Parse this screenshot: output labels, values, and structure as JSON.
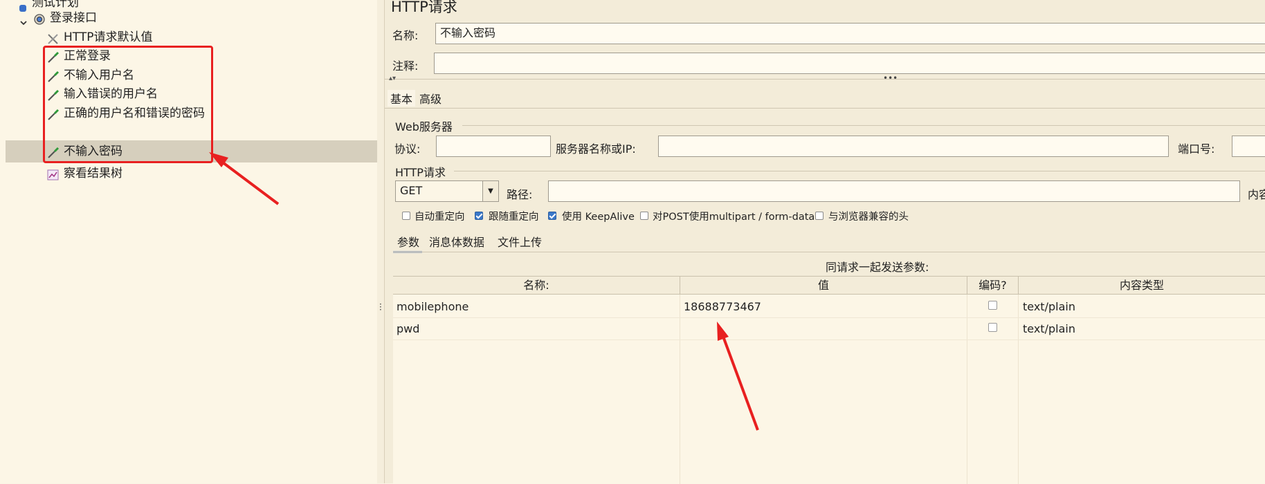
{
  "tree": {
    "items": [
      {
        "label": "测试计划"
      },
      {
        "label": "登录接口"
      },
      {
        "label": "HTTP请求默认值"
      },
      {
        "label": "正常登录"
      },
      {
        "label": "不输入用户名"
      },
      {
        "label": "输入错误的用户名"
      },
      {
        "label": "正确的用户名和错误的密码"
      },
      {
        "label": "不输入密码"
      },
      {
        "label": "察看结果树"
      }
    ]
  },
  "panel": {
    "title": "HTTP请求",
    "name_label": "名称:",
    "name_value": "不输入密码",
    "comment_label": "注释:",
    "comment_value": "",
    "tabs": [
      "基本",
      "高级"
    ],
    "web_server": {
      "group_label": "Web服务器",
      "protocol_label": "协议:",
      "protocol_value": "",
      "server_label": "服务器名称或IP:",
      "server_value": "",
      "port_label": "端口号:",
      "port_value": ""
    },
    "http_request": {
      "group_label": "HTTP请求",
      "method": "GET",
      "path_label": "路径:",
      "path_value": "",
      "content_encoding_label_partial": "内容",
      "options": [
        {
          "label": "自动重定向",
          "checked": false
        },
        {
          "label": "跟随重定向",
          "checked": true
        },
        {
          "label": "使用 KeepAlive",
          "checked": true
        },
        {
          "label": "对POST使用multipart / form-data",
          "checked": false
        },
        {
          "label": "与浏览器兼容的头",
          "checked": false
        }
      ]
    },
    "sub_tabs": [
      "参数",
      "消息体数据",
      "文件上传"
    ],
    "params_caption": "同请求一起发送参数:",
    "table": {
      "headers": [
        "名称:",
        "值",
        "编码?",
        "内容类型"
      ],
      "rows": [
        {
          "name": "mobilephone",
          "value": "18688773467",
          "encode": false,
          "content_type": "text/plain"
        },
        {
          "name": "pwd",
          "value": "",
          "encode": false,
          "content_type": "text/plain"
        }
      ]
    }
  },
  "colors": {
    "annotation": "#e82020",
    "selection": "#d6cfbd",
    "background": "#f3ecd9"
  }
}
